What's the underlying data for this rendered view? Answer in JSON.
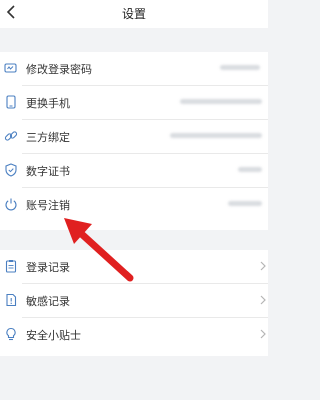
{
  "header": {
    "title": "设置",
    "back_icon": "chevron-left-icon"
  },
  "security_group": {
    "items": [
      {
        "label": "修改登录密码",
        "icon": "password-card-icon"
      },
      {
        "label": "更换手机",
        "icon": "phone-icon"
      },
      {
        "label": "三方绑定",
        "icon": "link-icon"
      },
      {
        "label": "数字证书",
        "icon": "shield-check-icon"
      },
      {
        "label": "账号注销",
        "icon": "power-icon"
      }
    ]
  },
  "records_group": {
    "items": [
      {
        "label": "登录记录",
        "icon": "clipboard-icon"
      },
      {
        "label": "敏感记录",
        "icon": "warning-doc-icon"
      },
      {
        "label": "安全小贴士",
        "icon": "lightbulb-icon"
      }
    ]
  },
  "colors": {
    "background": "#f2f3f5",
    "card": "#ffffff",
    "icon_blue": "#4a7fc1",
    "annotation_red": "#e02020"
  }
}
